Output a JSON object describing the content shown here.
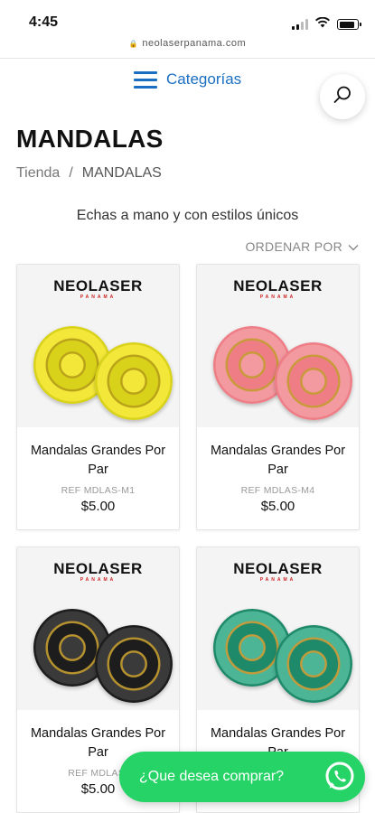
{
  "status_bar": {
    "time": "4:45"
  },
  "browser": {
    "url": "neolaserpanama.com"
  },
  "nav": {
    "categories_label": "Categorías"
  },
  "page": {
    "title": "MANDALAS",
    "breadcrumb": [
      "Tienda",
      "/",
      "MANDALAS"
    ],
    "subtitle": "Echas a mano y con estilos únicos",
    "sort_label": "ORDENAR POR"
  },
  "brand": {
    "logo_text": "NEOLASER",
    "logo_sub": "PANAMA"
  },
  "products": [
    {
      "name": "Mandalas Grandes Por Par",
      "ref": "REF MDLAS-M1",
      "price": "$5.00",
      "color_outer": "#d9d21a",
      "color_inner": "#f3e83a",
      "color_ring": "#b9a21a"
    },
    {
      "name": "Mandalas Grandes Por Par",
      "ref": "REF MDLAS-M4",
      "price": "$5.00",
      "color_outer": "#ef7d86",
      "color_inner": "#f29aa0",
      "color_ring": "#c89a3a"
    },
    {
      "name": "Mandalas Grandes Por Par",
      "ref": "REF MDLAS-",
      "price": "$5.00",
      "color_outer": "#1d1d1d",
      "color_inner": "#3a3a3a",
      "color_ring": "#b7932f"
    },
    {
      "name": "Mandalas Grandes Por Par",
      "ref": "",
      "price": "",
      "color_outer": "#1e8a6a",
      "color_inner": "#4cb596",
      "color_ring": "#c19b3c"
    }
  ],
  "whatsapp": {
    "label": "¿Que desea comprar?",
    "color": "#25d366"
  },
  "colors": {
    "accent": "#1b6fc2"
  }
}
